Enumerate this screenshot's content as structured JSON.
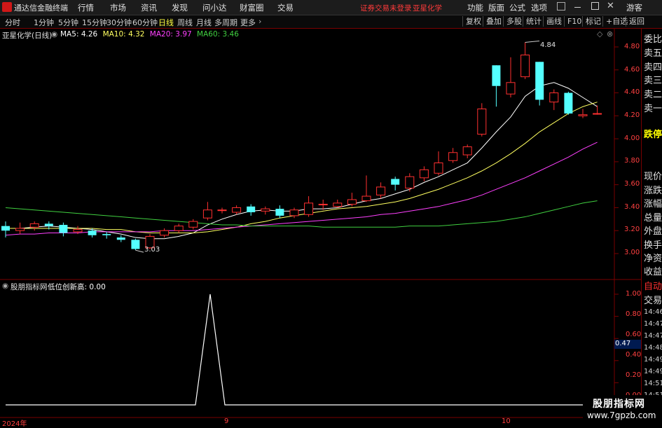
{
  "app": {
    "name": "通达信金融终端"
  },
  "menu": [
    "行情",
    "市场",
    "资讯",
    "发现",
    "问小达",
    "财富圈",
    "交易"
  ],
  "titlebar_notice": {
    "login": "证券交易未登录",
    "stock": "亚星化学"
  },
  "titlebar_right": [
    "功能",
    "版面",
    "公式",
    "选项",
    "游客"
  ],
  "periods": [
    {
      "label": "分时",
      "active": false
    },
    {
      "label": "1分钟",
      "active": false
    },
    {
      "label": "5分钟",
      "active": false
    },
    {
      "label": "15分钟",
      "active": false
    },
    {
      "label": "30分钟",
      "active": false
    },
    {
      "label": "60分钟",
      "active": false
    },
    {
      "label": "日线",
      "active": true
    },
    {
      "label": "周线",
      "active": false
    },
    {
      "label": "月线",
      "active": false
    },
    {
      "label": "多周期",
      "active": false
    },
    {
      "label": "更多",
      "active": false
    }
  ],
  "tools": [
    "复权",
    "叠加",
    "多股",
    "统计",
    "画线",
    "F10",
    "标记",
    "+自选",
    "返回"
  ],
  "main_chart": {
    "stock_label": "亚星化学(日线)",
    "ma": [
      {
        "name": "MA5",
        "value": "4.26",
        "color": "#ffffff"
      },
      {
        "name": "MA10",
        "value": "4.32",
        "color": "#ffff60"
      },
      {
        "name": "MA20",
        "value": "3.97",
        "color": "#ff40ff"
      },
      {
        "name": "MA60",
        "value": "3.46",
        "color": "#40d040"
      }
    ],
    "high_label": "4.84",
    "low_label": "3.03",
    "y_ticks": [
      "4.80",
      "4.60",
      "4.40",
      "4.20",
      "4.00",
      "3.80",
      "3.60",
      "3.40",
      "3.20",
      "3.00"
    ]
  },
  "sub_chart": {
    "indicator": "股朋指标网",
    "line_name": "低位创新高",
    "line_value": "0.00",
    "y_ticks": [
      "1.00",
      "0.80",
      "0.60",
      "0.40",
      "0.20",
      "0.00"
    ],
    "current_value": "0.47"
  },
  "x_axis": [
    "2024年",
    "9",
    "10"
  ],
  "right_panel": {
    "rows": [
      "委比",
      "卖五",
      "卖四",
      "卖三",
      "卖二",
      "卖一"
    ],
    "signal": "跌停",
    "rows2": [
      "现价",
      "涨跌",
      "涨幅",
      "总量",
      "外盘",
      "换手",
      "净资",
      "收益"
    ],
    "rows3": [
      "自动",
      "交易"
    ],
    "times": [
      "14:46",
      "14:47",
      "14:47",
      "14:48",
      "14:49",
      "14:49",
      "14:51",
      "14:51",
      "14:51"
    ]
  },
  "watermark": {
    "line1": "股朋指标网",
    "line2": "www.7gpzb.com"
  },
  "chart_data": {
    "type": "candlestick",
    "x_labels": [
      "2024年",
      "9",
      "10"
    ],
    "ylim": [
      2.95,
      4.9
    ],
    "candles": [
      [
        3.24,
        3.2,
        3.28,
        3.14
      ],
      [
        3.2,
        3.22,
        3.27,
        3.17
      ],
      [
        3.23,
        3.26,
        3.28,
        3.2
      ],
      [
        3.26,
        3.24,
        3.28,
        3.21
      ],
      [
        3.25,
        3.18,
        3.27,
        3.15
      ],
      [
        3.19,
        3.21,
        3.24,
        3.17
      ],
      [
        3.2,
        3.16,
        3.22,
        3.14
      ],
      [
        3.17,
        3.16,
        3.19,
        3.13
      ],
      [
        3.14,
        3.12,
        3.16,
        3.1
      ],
      [
        3.12,
        3.04,
        3.13,
        3.03
      ],
      [
        3.05,
        3.15,
        3.17,
        3.04
      ],
      [
        3.16,
        3.2,
        3.22,
        3.14
      ],
      [
        3.2,
        3.24,
        3.26,
        3.18
      ],
      [
        3.23,
        3.28,
        3.3,
        3.21
      ],
      [
        3.31,
        3.38,
        3.45,
        3.29
      ],
      [
        3.38,
        3.38,
        3.4,
        3.35
      ],
      [
        3.36,
        3.4,
        3.42,
        3.34
      ],
      [
        3.41,
        3.36,
        3.43,
        3.33
      ],
      [
        3.37,
        3.39,
        3.41,
        3.34
      ],
      [
        3.39,
        3.33,
        3.42,
        3.31
      ],
      [
        3.33,
        3.38,
        3.4,
        3.31
      ],
      [
        3.34,
        3.44,
        3.5,
        3.32
      ],
      [
        3.43,
        3.43,
        3.47,
        3.38
      ],
      [
        3.41,
        3.44,
        3.47,
        3.4
      ],
      [
        3.43,
        3.47,
        3.53,
        3.41
      ],
      [
        3.46,
        3.5,
        3.68,
        3.45
      ],
      [
        3.51,
        3.58,
        3.62,
        3.48
      ],
      [
        3.65,
        3.6,
        3.67,
        3.55
      ],
      [
        3.57,
        3.67,
        3.7,
        3.54
      ],
      [
        3.66,
        3.73,
        3.76,
        3.63
      ],
      [
        3.7,
        3.79,
        3.89,
        3.68
      ],
      [
        3.81,
        3.88,
        3.92,
        3.79
      ],
      [
        3.86,
        3.93,
        3.95,
        3.83
      ],
      [
        4.04,
        4.26,
        4.31,
        4.02
      ],
      [
        4.64,
        4.46,
        4.64,
        4.28
      ],
      [
        4.39,
        4.49,
        4.71,
        4.36
      ],
      [
        4.54,
        4.73,
        4.84,
        4.52
      ],
      [
        4.67,
        4.34,
        4.67,
        4.29
      ],
      [
        4.32,
        4.4,
        4.43,
        4.25
      ],
      [
        4.4,
        4.22,
        4.41,
        4.21
      ],
      [
        4.2,
        4.21,
        4.26,
        4.18
      ],
      [
        4.22,
        4.22,
        4.29,
        4.21
      ]
    ],
    "series": [
      {
        "name": "MA5",
        "values": [
          3.22,
          3.22,
          3.23,
          3.24,
          3.23,
          3.22,
          3.21,
          3.19,
          3.17,
          3.14,
          3.13,
          3.13,
          3.15,
          3.18,
          3.25,
          3.3,
          3.34,
          3.37,
          3.38,
          3.37,
          3.37,
          3.39,
          3.39,
          3.4,
          3.43,
          3.46,
          3.48,
          3.52,
          3.56,
          3.62,
          3.67,
          3.73,
          3.79,
          3.92,
          4.06,
          4.19,
          4.37,
          4.46,
          4.49,
          4.44,
          4.36,
          4.28
        ]
      },
      {
        "name": "MA10",
        "values": [
          3.22,
          3.22,
          3.22,
          3.22,
          3.22,
          3.22,
          3.22,
          3.21,
          3.21,
          3.19,
          3.18,
          3.18,
          3.18,
          3.18,
          3.19,
          3.21,
          3.23,
          3.26,
          3.28,
          3.31,
          3.33,
          3.35,
          3.37,
          3.39,
          3.4,
          3.41,
          3.43,
          3.45,
          3.48,
          3.52,
          3.56,
          3.61,
          3.66,
          3.72,
          3.79,
          3.87,
          3.96,
          4.06,
          4.14,
          4.22,
          4.28,
          4.32
        ]
      },
      {
        "name": "MA20",
        "values": [
          3.16,
          3.17,
          3.17,
          3.18,
          3.18,
          3.18,
          3.19,
          3.19,
          3.19,
          3.19,
          3.19,
          3.2,
          3.2,
          3.2,
          3.21,
          3.22,
          3.23,
          3.24,
          3.25,
          3.26,
          3.27,
          3.28,
          3.29,
          3.3,
          3.31,
          3.32,
          3.34,
          3.35,
          3.37,
          3.39,
          3.41,
          3.44,
          3.47,
          3.51,
          3.56,
          3.61,
          3.66,
          3.72,
          3.78,
          3.84,
          3.91,
          3.97
        ]
      },
      {
        "name": "MA60",
        "values": [
          3.4,
          3.39,
          3.38,
          3.37,
          3.36,
          3.35,
          3.34,
          3.33,
          3.32,
          3.31,
          3.3,
          3.29,
          3.28,
          3.27,
          3.26,
          3.25,
          3.25,
          3.24,
          3.24,
          3.24,
          3.24,
          3.24,
          3.23,
          3.23,
          3.23,
          3.23,
          3.23,
          3.23,
          3.24,
          3.24,
          3.24,
          3.25,
          3.26,
          3.27,
          3.28,
          3.3,
          3.32,
          3.35,
          3.38,
          3.41,
          3.44,
          3.46
        ]
      }
    ],
    "sub_series": {
      "name": "低位创新高",
      "x_index": [
        0,
        13,
        14,
        15,
        41
      ],
      "values": [
        0,
        0,
        1,
        0,
        0
      ]
    }
  }
}
